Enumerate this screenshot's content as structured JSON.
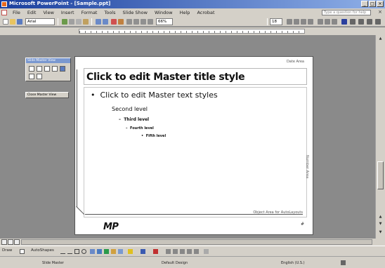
{
  "window": {
    "title": "Microsoft PowerPoint - [Sample.ppt]",
    "minimize": "_",
    "maximize": "□",
    "close": "×"
  },
  "menubar": {
    "items": [
      "File",
      "Edit",
      "View",
      "Insert",
      "Format",
      "Tools",
      "Slide Show",
      "Window",
      "Help",
      "Acrobat"
    ],
    "ask_placeholder": "Type a question for help",
    "close_doc": "×"
  },
  "toolbar": {
    "font_name": "Arial",
    "zoom": "66%",
    "font_size": "18"
  },
  "master_toolbar": {
    "title": "Slide Master View",
    "close_label": "Close Master View"
  },
  "slide": {
    "date_area": "Date Area",
    "title": "Click to edit Master title style",
    "levels": [
      "Click to edit Master text styles",
      "Second level",
      "Third level",
      "Fourth level",
      "Fifth level"
    ],
    "footer": "Object Area for AutoLayouts",
    "vertical": "Number Area",
    "logo": "MP",
    "page_number": "#"
  },
  "drawbar": {
    "draw_label": "Draw",
    "autoshapes_label": "AutoShapes"
  },
  "statusbar": {
    "view": "Slide Master",
    "design": "Default Design",
    "language": "English (U.S.)"
  },
  "colors": {
    "titlebar_start": "#1a3f9e",
    "titlebar_end": "#8fb0e8",
    "chrome": "#d4d0c8",
    "workspace": "#8a8a8a"
  }
}
